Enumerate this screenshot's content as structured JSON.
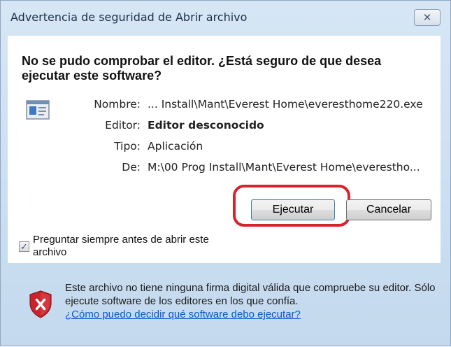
{
  "window": {
    "title": "Advertencia de seguridad de Abrir archivo",
    "close_glyph": "✕"
  },
  "main": {
    "heading": "No se pudo comprobar el editor. ¿Está seguro de que desea ejecutar este software?",
    "icon": "application-window-icon",
    "details": [
      {
        "label": "Nombre:",
        "value": "... Install\\Mant\\Everest Home\\everesthome220.exe"
      },
      {
        "label": "Editor:",
        "value": "Editor desconocido"
      },
      {
        "label": "Tipo:",
        "value": "Aplicación"
      },
      {
        "label": "De:",
        "value": "M:\\00 Prog Install\\Mant\\Everest Home\\everestho..."
      }
    ]
  },
  "buttons": {
    "run_label": "Ejecutar",
    "cancel_label": "Cancelar"
  },
  "checkbox": {
    "checked": true,
    "label": "Preguntar siempre antes de abrir este archivo"
  },
  "footer": {
    "icon": "shield-warning-icon",
    "text": "Este archivo no tiene ninguna firma digital válida que compruebe su editor. Sólo ejecute software de los editores en los que confía.",
    "link": "¿Cómo puedo decidir qué software debo ejecutar?"
  },
  "colors": {
    "highlight": "#d8232f",
    "titlebar": "#c4d9ee",
    "link": "#0a58c8",
    "shield_red": "#c8242b"
  }
}
